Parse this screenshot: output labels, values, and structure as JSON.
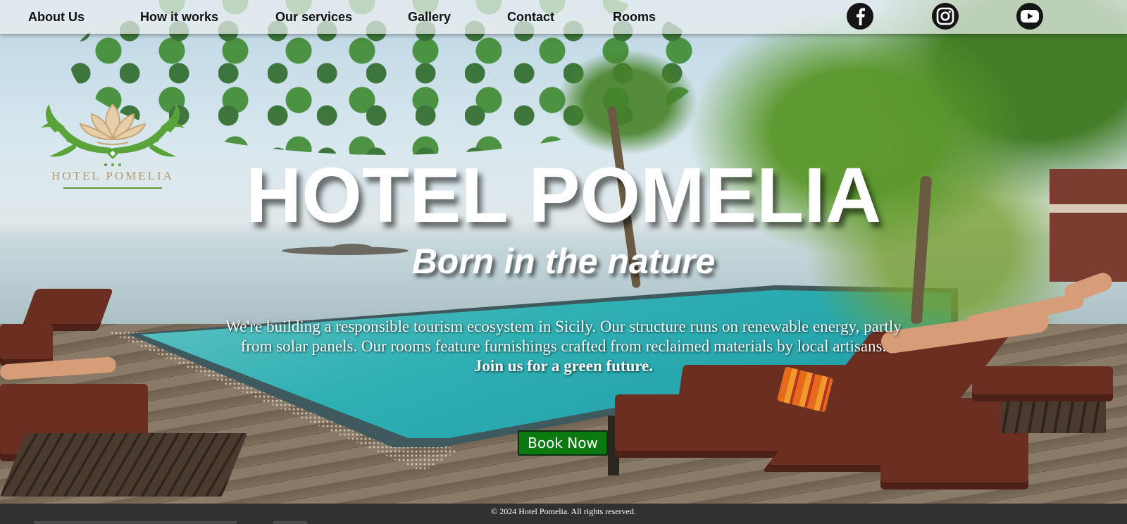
{
  "nav": {
    "links": [
      "About Us",
      "How it works",
      "Our services",
      "Gallery",
      "Contact",
      "Rooms"
    ],
    "social": [
      {
        "icon": "facebook-icon"
      },
      {
        "icon": "instagram-icon"
      },
      {
        "icon": "youtube-icon"
      }
    ]
  },
  "logo": {
    "text": "HOTEL POMELIA",
    "colors": {
      "lotus": "#c9a476",
      "leaves": "#5aa23a"
    }
  },
  "hero": {
    "title": "HOTEL POMELIA",
    "subtitle": "Born in the nature",
    "description": "We're building a responsible tourism ecosystem in Sicily. Our structure runs on renewable energy, partly from solar panels. Our rooms feature furnishings crafted from reclaimed materials by local artisans.",
    "cta_text": "Join us for a green future.",
    "button_label": "Book Now"
  },
  "footer": {
    "text": "© 2024 Hotel Pomelia. All rights reserved."
  },
  "colors": {
    "button_bg": "#0a7a10",
    "footer_bg": "#303231"
  }
}
